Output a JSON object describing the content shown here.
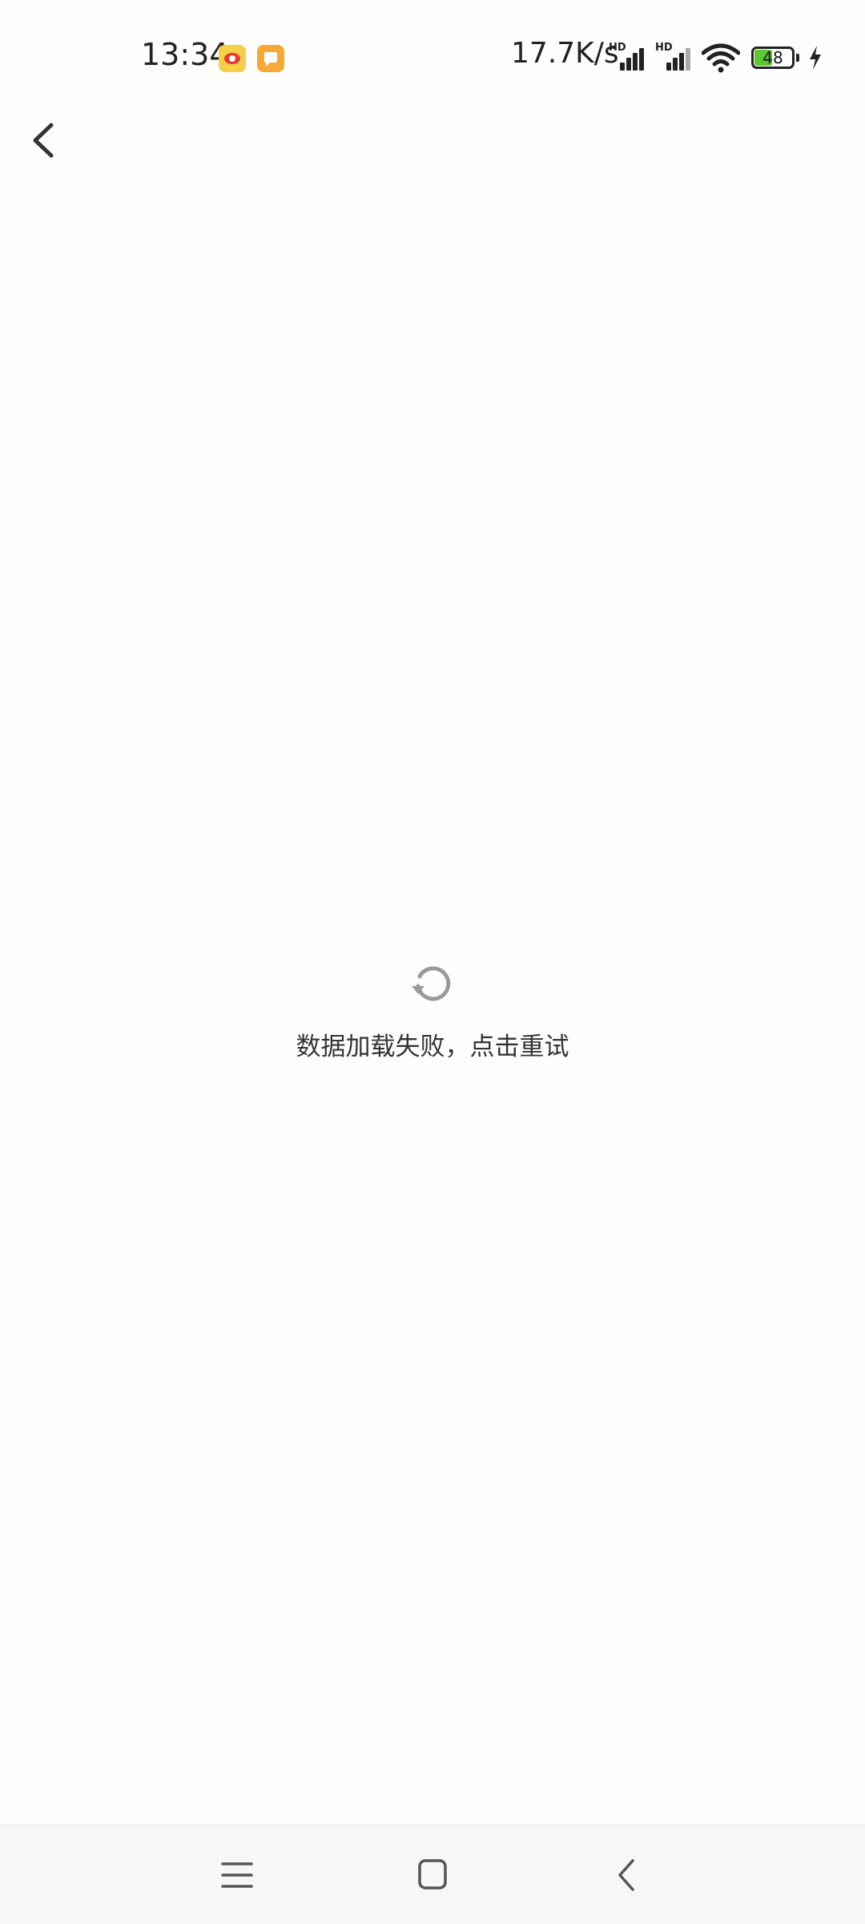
{
  "status_bar": {
    "time": "13:34",
    "network_speed": "17.7K/s",
    "signal_1_label": "HD",
    "signal_2_label": "HD",
    "battery_level": "48",
    "notification_icons": [
      "weibo-icon",
      "message-icon"
    ],
    "battery_color": "#5ec631"
  },
  "header": {
    "back_icon": "chevron-left-icon"
  },
  "error_state": {
    "icon": "refresh-icon",
    "message": "数据加载失败，点击重试"
  },
  "nav_bar": {
    "buttons": [
      "menu-icon",
      "home-icon",
      "back-icon"
    ]
  }
}
